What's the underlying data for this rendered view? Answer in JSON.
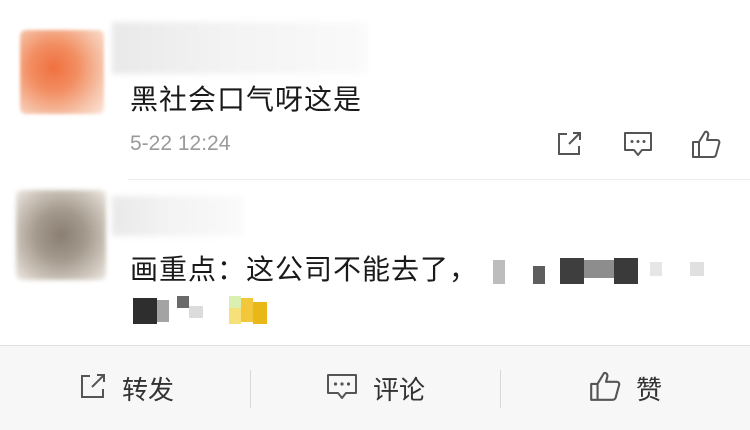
{
  "comments": [
    {
      "text": "黑社会口气呀这是",
      "timestamp": "5-22 12:24"
    },
    {
      "text": "画重点：这公司不能去了，"
    }
  ],
  "actions": {
    "share_label": "转发",
    "comment_label": "评论",
    "like_label": "赞"
  },
  "colors": {
    "icon": "#555555",
    "timestamp": "#9a9a9a",
    "bar_background": "#f7f7f7"
  },
  "icons": {
    "share": "share-icon",
    "comment": "comment-icon",
    "like": "thumbs-up-icon"
  }
}
